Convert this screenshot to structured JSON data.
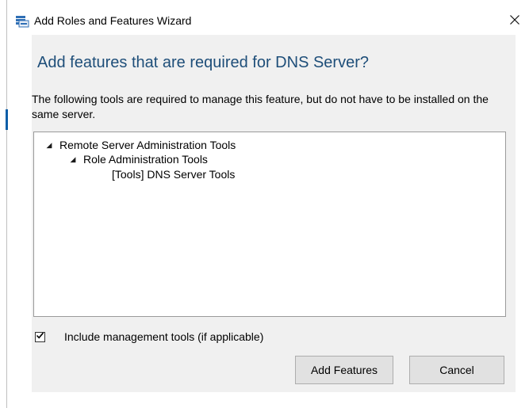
{
  "window": {
    "title": "Add Roles and Features Wizard",
    "close_icon": "close-icon",
    "app_icon": "server-wizard-icon"
  },
  "dialog": {
    "heading": "Add features that are required for DNS Server?",
    "description": "The following tools are required to manage this feature, but do not have to be installed on the same server.",
    "tree": {
      "items": [
        {
          "label": "Remote Server Administration Tools",
          "expanded": true,
          "level": 0
        },
        {
          "label": "Role Administration Tools",
          "expanded": true,
          "level": 1
        },
        {
          "label": "[Tools] DNS Server Tools",
          "expanded": null,
          "level": 2
        }
      ],
      "expand_glyph": "◢"
    },
    "include_tools": {
      "label": "Include management tools (if applicable)",
      "checked": true
    },
    "buttons": {
      "add_features": "Add Features",
      "cancel": "Cancel"
    }
  },
  "colors": {
    "heading": "#1e4e79",
    "content_bg": "#f0f0f0",
    "button_bg": "#e1e1e1",
    "accent": "#0b5ea8"
  }
}
